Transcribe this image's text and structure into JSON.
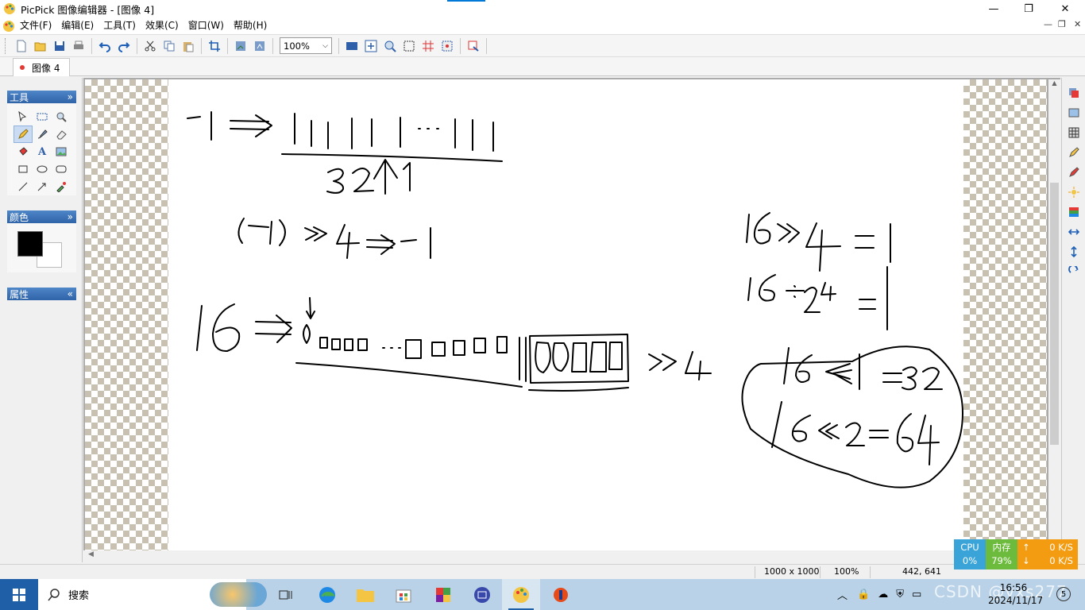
{
  "window": {
    "title": "PicPick 图像编辑器 - [图像 4]",
    "minimize_icon": "minimize-icon",
    "maximize_icon": "restore-icon",
    "close_icon": "close-icon"
  },
  "menu": {
    "items": [
      "文件(F)",
      "编辑(E)",
      "工具(T)",
      "效果(C)",
      "窗口(W)",
      "帮助(H)"
    ]
  },
  "toolbar": {
    "zoom_value": "100%"
  },
  "tabs": [
    {
      "label": "图像 4"
    }
  ],
  "panels": {
    "tools_title": "工具",
    "colors_title": "颜色",
    "properties_title": "属性",
    "primary_color": "#000000",
    "secondary_color": "#ffffff"
  },
  "statusbar": {
    "image_size": "1000 x 1000",
    "zoom": "100%",
    "cursor": "442, 641"
  },
  "perf": {
    "cpu_label": "CPU",
    "cpu_value": "0%",
    "mem_label": "内存",
    "mem_value": "79%",
    "up_speed": "0 K/S",
    "down_speed": "0 K/S"
  },
  "taskbar": {
    "search_placeholder": "搜索",
    "time": "16:56",
    "date": "2024/11/17",
    "notification_count": "5",
    "watermark": "CSDN @yxs277"
  }
}
